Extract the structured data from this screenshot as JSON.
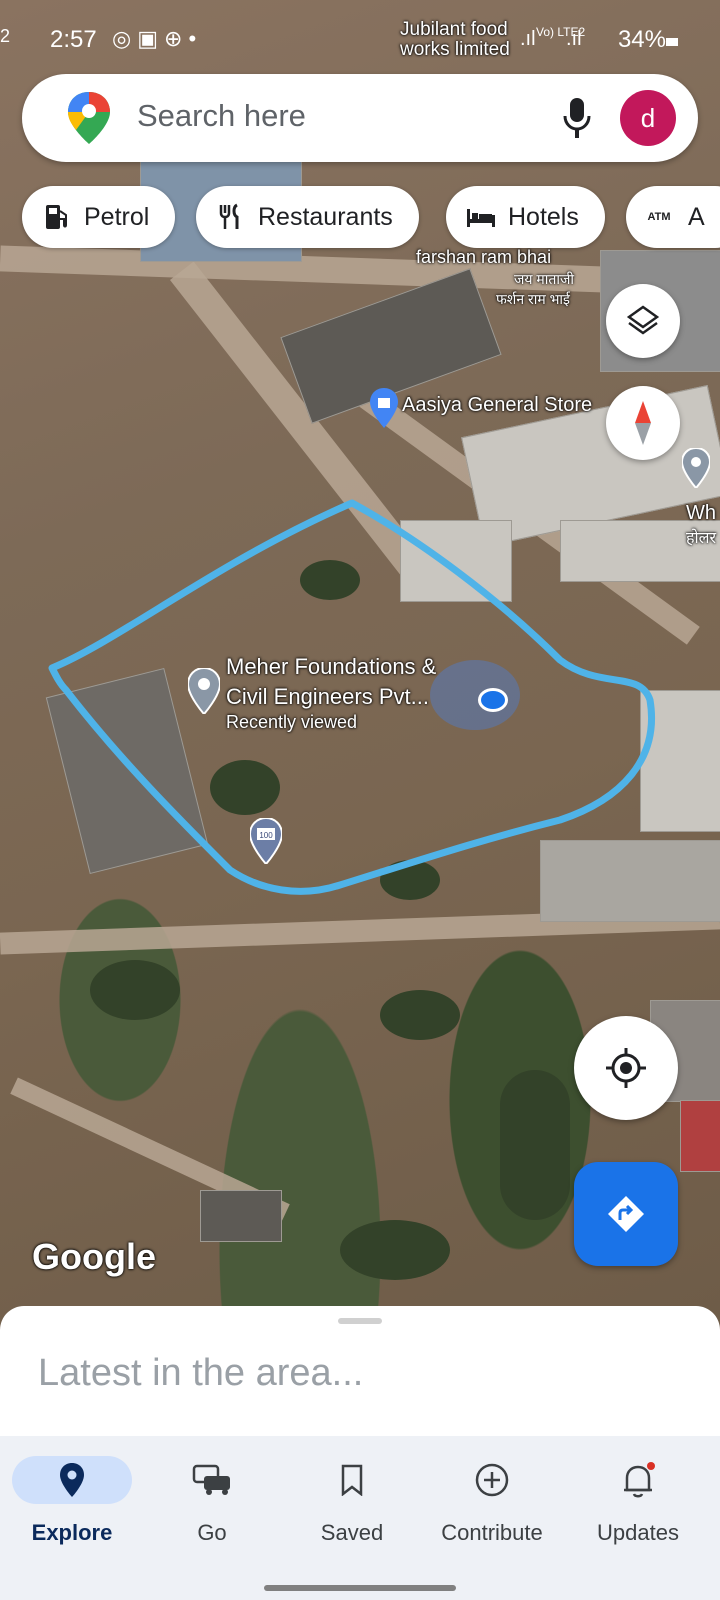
{
  "status_bar": {
    "left_edge": "2",
    "time": "2:57",
    "notification_icons": [
      "whatsapp-icon",
      "image-icon",
      "grid-icon"
    ],
    "network": "Vo) LTE2",
    "battery": "34%"
  },
  "search": {
    "placeholder": "Search here",
    "avatar_letter": "d"
  },
  "chips": [
    {
      "label": "Petrol",
      "icon": "fuel-pump-icon"
    },
    {
      "label": "Restaurants",
      "icon": "fork-knife-icon"
    },
    {
      "label": "Hotels",
      "icon": "bed-icon"
    },
    {
      "label": "A",
      "icon": "atm-icon"
    }
  ],
  "map_labels": {
    "jubilant": "Jubilant food\nworks limited",
    "farshan": "farshan ram bhai",
    "farshan_hi1": "जय माताजी",
    "farshan_hi2": "फर्शन राम भाई",
    "aasiya": "Aasiya General Store",
    "meher_line1": "Meher Foundations &",
    "meher_line2": "Civil Engineers Pvt...",
    "meher_sub": "Recently viewed",
    "wh_line1": "Wh",
    "wh_line2": "होलर",
    "pin100": "100",
    "google": "Google"
  },
  "sheet": {
    "latest": "Latest in the area..."
  },
  "nav": {
    "explore": "Explore",
    "go": "Go",
    "saved": "Saved",
    "contribute": "Contribute",
    "updates": "Updates"
  },
  "colors": {
    "accent_blue": "#1a73e8",
    "outline_blue": "#4fb3e8",
    "avatar": "#c2185b"
  }
}
